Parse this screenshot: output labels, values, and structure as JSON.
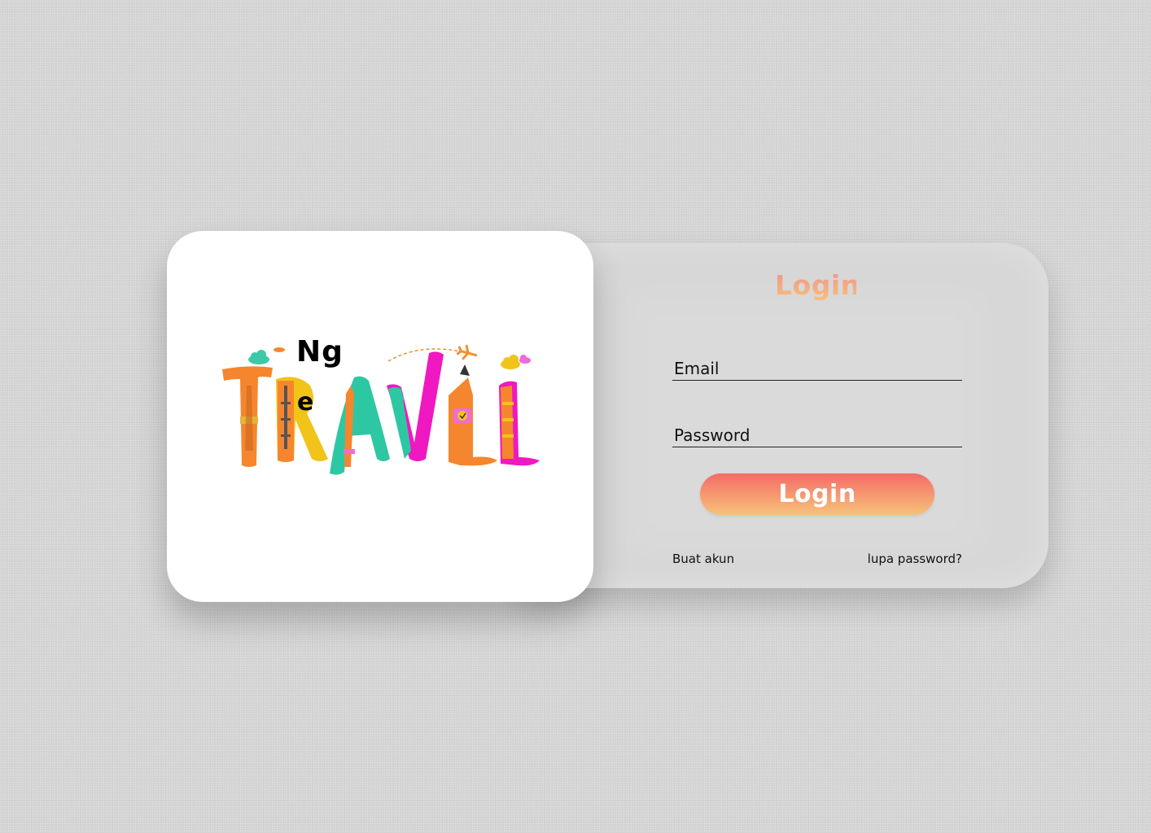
{
  "brand": {
    "prefix": "Ng",
    "letter": "e",
    "word": "TRAVEL"
  },
  "login": {
    "title": "Login",
    "email_placeholder": "Email",
    "password_placeholder": "Password",
    "button_label": "Login",
    "create_account": "Buat akun",
    "forgot_password": "lupa password?"
  },
  "colors": {
    "accent_start": "#f56b67",
    "accent_end": "#f6c27a",
    "panel": "#d7d7d7",
    "card": "#ffffff"
  }
}
